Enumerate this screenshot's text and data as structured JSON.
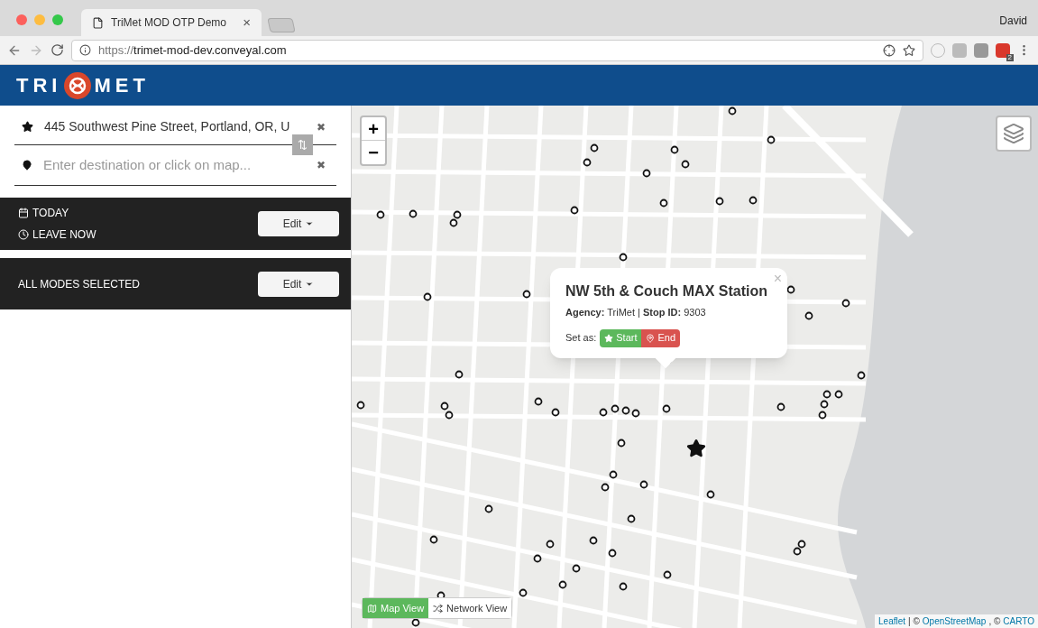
{
  "browser": {
    "tab_title": "TriMet MOD OTP Demo",
    "tab_close": "×",
    "user": "David",
    "url_scheme": "https://",
    "url_host": "trimet-mod-dev.conveyal.com",
    "badge": "2"
  },
  "header": {
    "logo_left": "TRI",
    "logo_right": "MET"
  },
  "sidebar": {
    "origin": {
      "value": "445 Southwest Pine Street, Portland, OR, U",
      "clear": "✖"
    },
    "destination": {
      "placeholder": "Enter destination or click on map...",
      "clear": "✖"
    },
    "swap": "⇅",
    "when": {
      "date": "TODAY",
      "time": "LEAVE NOW",
      "button": "Edit"
    },
    "modes": {
      "label": "ALL MODES SELECTED",
      "button": "Edit"
    }
  },
  "map": {
    "zoom_in": "+",
    "zoom_out": "−",
    "popup": {
      "title": "NW 5th & Couch MAX Station",
      "details": "**Agency:** TriMet | **Stop ID:** 9303",
      "set_as": "Set as:",
      "start": "Start",
      "end": "End",
      "close": "×"
    },
    "views": [
      {
        "label": "Map View",
        "kind": "map",
        "selected": true
      },
      {
        "label": "Network View",
        "kind": "network",
        "selected": false
      }
    ],
    "attribution": {
      "leaflet": "Leaflet",
      "sep1": "| ©",
      "osm": "OpenStreetMap",
      "sep2": ", ©",
      "carto": "CARTO"
    }
  }
}
